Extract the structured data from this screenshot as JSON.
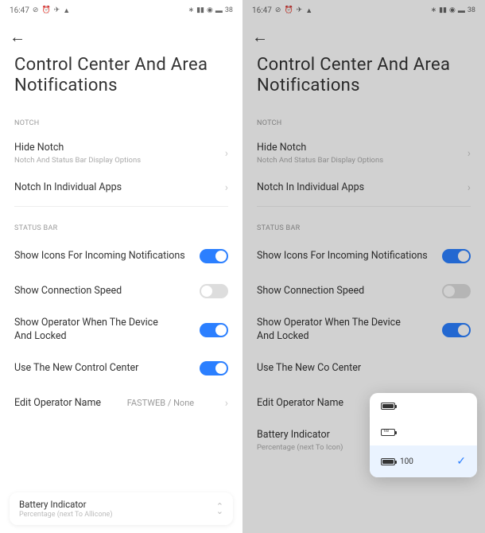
{
  "statusbar": {
    "time": "16:47",
    "battery_pct": "38",
    "battery_pct_right": "38"
  },
  "nav": {
    "back_glyph": "←"
  },
  "title": "Control Center And Area Notifications",
  "sections": {
    "notch_header": "NOTCH",
    "statusbar_header": "STATUS BAR"
  },
  "rows": {
    "hide_notch": {
      "label": "Hide Notch",
      "sub": "Notch And Status Bar Display Options"
    },
    "notch_apps": {
      "label": "Notch In Individual Apps"
    },
    "show_icons": {
      "label": "Show Icons For Incoming Notifications"
    },
    "conn_speed": {
      "label": "Show Connection Speed"
    },
    "show_operator": {
      "label": "Show Operator When The Device And Locked"
    },
    "use_cc": {
      "label": "Use The New Control Center"
    },
    "use_cc_truncated": {
      "label": "Use The New Co Center"
    },
    "edit_operator": {
      "label": "Edit Operator Name",
      "value": "FASTWEB / None"
    },
    "battery_indicator": {
      "label": "Battery Indicator",
      "sub_left": "Percentage (next To Allicone)",
      "sub_right": "Percentage (next To Icon)"
    }
  },
  "popup": {
    "option_pct": "100"
  },
  "glyphs": {
    "chevron": "›",
    "bt": "✳",
    "signal": "📶",
    "wifi": "📶",
    "alarm": "⏰",
    "dnd": "🔕",
    "plane": "✈",
    "cloud": "☁"
  }
}
